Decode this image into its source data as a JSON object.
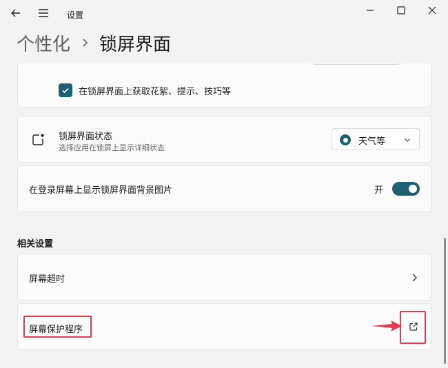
{
  "window": {
    "title": "设置",
    "icons": {
      "back": "back-arrow-icon",
      "menu": "hamburger-menu-icon",
      "minimize": "minimize-icon",
      "maximize": "maximize-icon",
      "close": "close-icon"
    }
  },
  "breadcrumb": {
    "parent": "个性化",
    "separator_icon": "chevron-right-icon",
    "current": "锁屏界面"
  },
  "settings": {
    "tips_checkbox": {
      "label": "在锁屏界面上获取花絮、提示、技巧等",
      "checked": true
    },
    "lock_status": {
      "title": "锁屏界面状态",
      "subtitle": "选择应用在锁屏上显示详细状态",
      "dropdown_value": "天气等",
      "icon": "lock-screen-status-icon"
    },
    "show_background": {
      "label": "在登录屏幕上显示锁屏界面背景图片",
      "toggle_text": "开",
      "toggle_on": true
    }
  },
  "related": {
    "heading": "相关设置",
    "items": [
      {
        "label": "屏幕超时",
        "icon": "chevron-right-icon"
      },
      {
        "label": "屏幕保护程序",
        "icon": "open-external-icon"
      }
    ]
  },
  "colors": {
    "accent": "#1f5f72",
    "annotation": "#e8394f",
    "background": "#f3f3f3",
    "card": "#fbfbfb"
  }
}
